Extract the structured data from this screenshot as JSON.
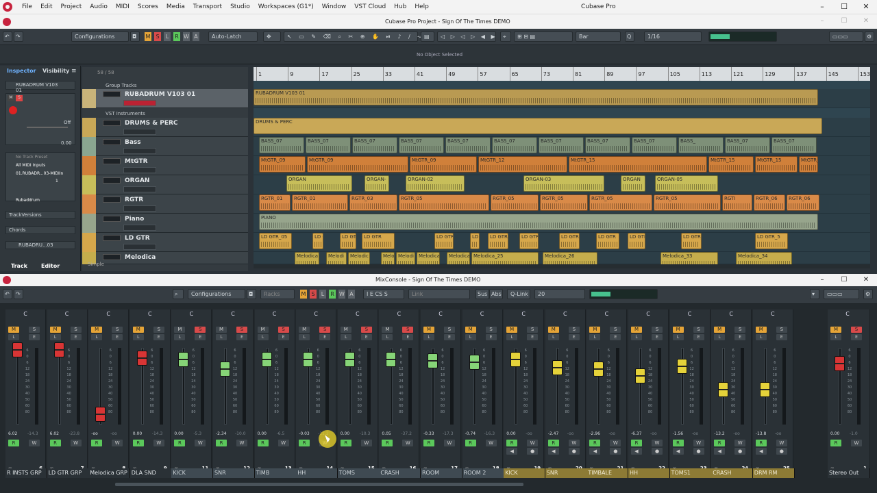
{
  "app": {
    "menu": [
      "File",
      "Edit",
      "Project",
      "Audio",
      "MIDI",
      "Scores",
      "Media",
      "Transport",
      "Studio",
      "Workspaces (G1*)",
      "Window",
      "VST Cloud",
      "Hub",
      "Help"
    ],
    "title": "Cubase Pro",
    "project_title": "Cubase Pro Project - Sign Of The Times DEMO"
  },
  "toolbar": {
    "configurations": "Configurations",
    "msrwa": [
      "M",
      "S",
      "L",
      "R",
      "W",
      "A"
    ],
    "automation": "Auto-Latch",
    "grid_type": "Bar",
    "quantize": "1/16",
    "info": "No Object Selected"
  },
  "inspector": {
    "tabs": [
      "Inspector",
      "Visibility"
    ],
    "track_name": "RUBADRUM V103 01",
    "off_label": "Off",
    "value": "0.00",
    "no_preset": "No Track Preset",
    "input": "All MIDI Inputs",
    "output": "01.RUBADR...03-MIDIIn",
    "channel": "1",
    "instrument": "Rubaddrum",
    "sections": [
      "TrackVersions",
      "Chords"
    ],
    "bottom_track": "RUBADRU...03",
    "bottom_tabs": [
      "Track",
      "Editor"
    ]
  },
  "tracklist": {
    "count": "58 / 58",
    "group_header": "Group Tracks",
    "vst_header": "VST Instruments",
    "tracks": [
      "RUBADRUM V103 01",
      "DRUMS & PERC",
      "Bass",
      "MtGTR",
      "ORGAN",
      "RGTR",
      "Piano",
      "LD GTR",
      "Melodica"
    ],
    "simple": "Simple"
  },
  "ruler": [
    "1",
    "9",
    "17",
    "25",
    "33",
    "41",
    "49",
    "57",
    "65",
    "73",
    "81",
    "89",
    "97",
    "105",
    "113",
    "121",
    "129",
    "137",
    "145",
    "153"
  ],
  "clips": {
    "rubadrum": "RUBADRUM V103 01",
    "drums": "DRUMS & PERC",
    "bass": "BASS_07",
    "bass_short": "BASS_",
    "mtgtr": [
      "MtGTR_09",
      "MtGTR_09",
      "MtGTR_09",
      "MtGTR_12",
      "MtGTR_15",
      "MtGTR_15",
      "MtGTR_15",
      "MtGTR_15"
    ],
    "organ": [
      "ORGAN",
      "ORGAN-",
      "ORGAN-02",
      "ORGAN-03",
      "ORGAN",
      "ORGAN-05"
    ],
    "rgtr": [
      "RGTR_01",
      "RGTR_01",
      "RGTR_03",
      "RGTR_05",
      "RGTR_05",
      "RGTR_05",
      "RGTR_05",
      "RGTR_05",
      "RGTI",
      "RGTR_06",
      "RGTR_06"
    ],
    "piano": "PIANO",
    "ldgtr": [
      "LD GTR_05",
      "LD GTR",
      "LD GTR_19",
      "LD GTR",
      "LD GTR",
      "LD GTR",
      "LD GTR",
      "LD GTR_",
      "LD GTR",
      "LD GTR",
      "LD GTR",
      "LD GTR_5",
      "LD GTR_5"
    ],
    "melodica": [
      "Melodica",
      "Melodi",
      "Melodic",
      "Melo",
      "Melodi",
      "Melodica",
      "Melodica_",
      "Melodica_25",
      "Melodica_26",
      "Melodica_33",
      "Melodica_34"
    ]
  },
  "mixconsole": {
    "title": "MixConsole - Sign Of The Times DEMO",
    "configurations": "Configurations",
    "racks": "Racks",
    "buttons": [
      "M",
      "S",
      "L",
      "R",
      "W",
      "A",
      "I",
      "E",
      "CS",
      "S"
    ],
    "link": "Link",
    "sus": "Sus",
    "abs": "Abs",
    "qlink": "Q-Link",
    "zoom": "20",
    "scale": [
      "6",
      "0",
      "6",
      "12",
      "18",
      "24",
      "30",
      "40",
      "50",
      "60",
      "80"
    ],
    "channels": [
      {
        "name": "R INSTS GRP",
        "num": "6",
        "val": "6.02",
        "peak": "-14.3"
      },
      {
        "name": "LD GTR GRP",
        "num": "7",
        "val": "6.02",
        "peak": "-23.8"
      },
      {
        "name": "Melodica GRP",
        "num": "8",
        "val": "-oo",
        "peak": "-oo"
      },
      {
        "name": "DLA SND",
        "num": "9",
        "val": "0.00",
        "peak": "-14.3"
      },
      {
        "name": "KICK",
        "num": "11",
        "val": "0.00",
        "peak": "-5.3"
      },
      {
        "name": "SNR",
        "num": "12",
        "val": "-2.34",
        "peak": "-10.0"
      },
      {
        "name": "TIMB",
        "num": "13",
        "val": "0.00",
        "peak": "-6.5"
      },
      {
        "name": "HH",
        "num": "14",
        "val": "-0.03",
        "peak": "-11.2"
      },
      {
        "name": "TOMS",
        "num": "15",
        "val": "0.00",
        "peak": "-10.3"
      },
      {
        "name": "CRASH",
        "num": "16",
        "val": "0.05",
        "peak": "-37.2"
      },
      {
        "name": "ROOM",
        "num": "17",
        "val": "-0.33",
        "peak": "-17.3"
      },
      {
        "name": "ROOM 2",
        "num": "18",
        "val": "-0.74",
        "peak": "-16.3"
      },
      {
        "name": "KICK",
        "num": "19",
        "val": "0.00",
        "peak": "-oo"
      },
      {
        "name": "SNR",
        "num": "20",
        "val": "-2.47",
        "peak": "-oo"
      },
      {
        "name": "TIMBALE",
        "num": "21",
        "val": "-2.96",
        "peak": "-oo"
      },
      {
        "name": "HH",
        "num": "22",
        "val": "-6.37",
        "peak": "-oo"
      },
      {
        "name": "TOMS1",
        "num": "23",
        "val": "-1.56",
        "peak": "-oo"
      },
      {
        "name": "CRASH",
        "num": "24",
        "val": "-13.2",
        "peak": "-oo"
      },
      {
        "name": "DRM RM",
        "num": "25",
        "val": "-13.8",
        "peak": "-oo"
      }
    ],
    "stereo_out": {
      "name": "Stereo Out",
      "num": "1",
      "val": "0.00",
      "peak": "-1.0"
    }
  },
  "colors": {
    "accent": "#c7233e",
    "group": "#b99a52",
    "drums": "#c9a857",
    "bass": "#7e9078",
    "mtgtr": "#d0803a",
    "organ": "#c7be5a",
    "rgtr": "#d98a48",
    "piano": "#97a58c",
    "ldgtr": "#d6a74b",
    "melodica": "#c5ad4c",
    "fader_red": "#d83535",
    "fader_green": "#86d477",
    "fader_yellow": "#e5d23a"
  }
}
